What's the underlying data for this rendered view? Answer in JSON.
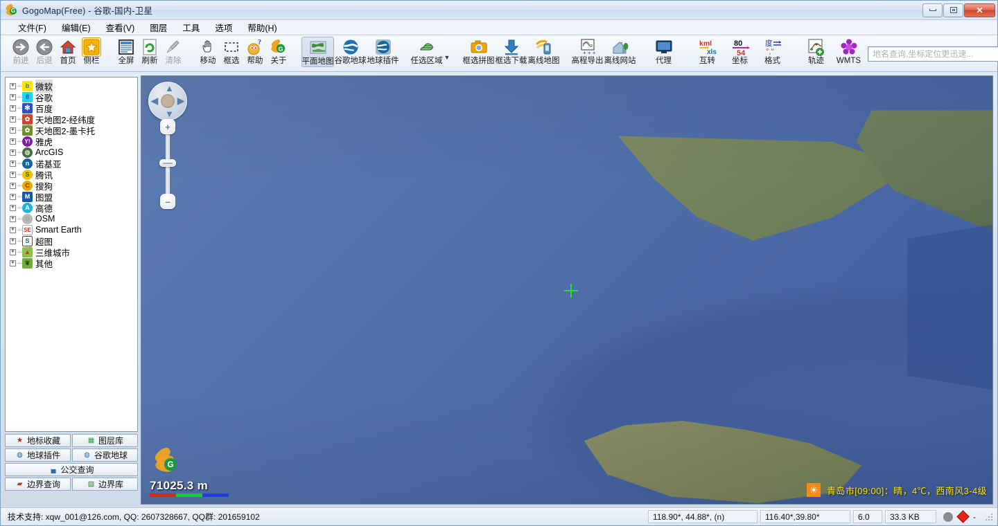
{
  "window": {
    "title": "GogoMap(Free) - 谷歌-国内-卫星",
    "logo_letter": "G",
    "minimize": "—",
    "maximize": "❐",
    "close": "✕"
  },
  "menubar": {
    "items": [
      {
        "label": "文件(F)"
      },
      {
        "label": "编辑(E)"
      },
      {
        "label": "查看(V)"
      },
      {
        "label": "图层"
      },
      {
        "label": "工具"
      },
      {
        "label": "选项"
      },
      {
        "label": "帮助(H)"
      }
    ]
  },
  "toolbar": {
    "groups": [
      {
        "buttons": [
          {
            "label": "前进",
            "icon": "arrow-right-circle-icon",
            "dim": true,
            "glyph": "➜",
            "color": "#5a5a5a"
          },
          {
            "label": "后退",
            "icon": "arrow-left-circle-icon",
            "dim": true,
            "glyph": "➜",
            "color": "#5a5a5a"
          },
          {
            "label": "首页",
            "icon": "home-icon",
            "dim": false,
            "glyph": "⌂",
            "color": "#c0392b"
          },
          {
            "label": "侧栏",
            "icon": "sidebar-star-icon",
            "dim": false,
            "glyph": "★",
            "color": "#f0a500",
            "selected": true
          }
        ]
      },
      {
        "buttons": [
          {
            "label": "全屏",
            "icon": "fullscreen-icon",
            "dim": false,
            "glyph": "▤",
            "color": "#2b6cb0"
          },
          {
            "label": "刷新",
            "icon": "refresh-icon",
            "dim": false,
            "glyph": "↻",
            "color": "#2e8b2e"
          },
          {
            "label": "清除",
            "icon": "broom-icon",
            "dim": true,
            "glyph": "🧹",
            "color": "#8a8a8a"
          }
        ]
      },
      {
        "buttons": [
          {
            "label": "移动",
            "icon": "hand-pan-icon",
            "dim": false,
            "glyph": "✋",
            "color": "#555"
          },
          {
            "label": "框选",
            "icon": "marquee-icon",
            "dim": false,
            "glyph": "▭",
            "color": "#555"
          },
          {
            "label": "帮助",
            "icon": "help-face-icon",
            "dim": false,
            "glyph": "?",
            "color": "#e8a33d"
          },
          {
            "label": "关于",
            "icon": "about-logo-icon",
            "dim": false,
            "glyph": "G",
            "color": "#1a9a3c"
          }
        ]
      },
      {
        "buttons": [
          {
            "label": "平面地图",
            "icon": "flat-map-icon",
            "dim": false,
            "glyph": "🌎",
            "color": "#2f7d32",
            "selected2": true
          },
          {
            "label": "谷歌地球",
            "icon": "google-earth-icon",
            "dim": false,
            "glyph": "◍",
            "color": "#1f6fb4"
          },
          {
            "label": "地球插件",
            "icon": "earth-plugin-icon",
            "dim": false,
            "glyph": "◍",
            "color": "#16669e"
          }
        ]
      },
      {
        "buttons": [
          {
            "label": "任选区域",
            "icon": "select-region-icon",
            "dim": false,
            "glyph": "▱",
            "color": "#2f9e44",
            "dropdown": true
          }
        ]
      },
      {
        "buttons": [
          {
            "label": "框选拼图",
            "icon": "camera-stitch-icon",
            "dim": false,
            "glyph": "📷",
            "color": "#f0a500"
          },
          {
            "label": "框选下载",
            "icon": "download-icon",
            "dim": false,
            "glyph": "⬇",
            "color": "#1f6fb4"
          },
          {
            "label": "离线地图",
            "icon": "offline-map-icon",
            "dim": false,
            "glyph": "📱",
            "color": "#f0a500"
          }
        ]
      },
      {
        "buttons": [
          {
            "label": "高程导出",
            "icon": "elevation-export-icon",
            "dim": false,
            "glyph": "▨",
            "color": "#333"
          },
          {
            "label": "离线网站",
            "icon": "offline-site-icon",
            "dim": false,
            "glyph": "⌂",
            "color": "#5a7fa8"
          }
        ]
      },
      {
        "buttons": [
          {
            "label": "代理",
            "icon": "proxy-monitor-icon",
            "dim": false,
            "glyph": "▭",
            "color": "#1c3d66"
          }
        ]
      },
      {
        "buttons": [
          {
            "label": "互转",
            "icon": "kml-xls-convert-icon",
            "dim": false,
            "glyph": "kml",
            "color": "#d93025"
          },
          {
            "label": "坐标",
            "icon": "coordinate-icon",
            "dim": false,
            "glyph": "80",
            "color": "#111"
          },
          {
            "label": "格式",
            "icon": "format-icon",
            "dim": false,
            "glyph": "度",
            "color": "#2b3fa0"
          }
        ]
      },
      {
        "buttons": [
          {
            "label": "轨迹",
            "icon": "track-icon",
            "dim": false,
            "glyph": "⤳",
            "color": "#c0392b"
          },
          {
            "label": "WMTS",
            "icon": "wmts-icon",
            "dim": false,
            "glyph": "✺",
            "color": "#a324c4"
          }
        ]
      }
    ],
    "kml_top": "kml",
    "kml_bottom": "xls",
    "coord_top": "80",
    "coord_bottom": "54",
    "format_top": "度",
    "format_bottom": "°,''"
  },
  "search": {
    "placeholder": "地名查询,坐标定位更迅速...",
    "value": ""
  },
  "sidebar": {
    "tree": [
      {
        "label": "微软",
        "expander": "+",
        "icon_letter": "b",
        "bg": "#ffe400",
        "fg": "#2b6cb0",
        "selected": true
      },
      {
        "label": "谷歌",
        "expander": "+",
        "icon_letter": "8",
        "bg": "#21d4f0",
        "fg": "#1559a8"
      },
      {
        "label": "百度",
        "expander": "+",
        "icon_letter": "熊",
        "bg": "#2b52c4",
        "fg": "#ffffff"
      },
      {
        "label": "天地图2-经纬度",
        "expander": "+",
        "icon_letter": "★",
        "bg": "#d0452e",
        "fg": "#ffffff"
      },
      {
        "label": "天地图2-墨卡托",
        "expander": "+",
        "icon_letter": "★",
        "bg": "#6f8f2a",
        "fg": "#ffffff"
      },
      {
        "label": "雅虎",
        "expander": "+",
        "icon_letter": "Y!",
        "bg": "#7b1fa2",
        "fg": "#ffffff"
      },
      {
        "label": "ArcGIS",
        "expander": "+",
        "icon_letter": "◍",
        "bg": "#4a6b4a",
        "fg": "#ffffff"
      },
      {
        "label": "诺基亚",
        "expander": "+",
        "icon_letter": "n",
        "bg": "#12639e",
        "fg": "#ffffff"
      },
      {
        "label": "腾讯",
        "expander": "+",
        "icon_letter": "S",
        "bg": "#f2c200",
        "fg": "#1a7a2e"
      },
      {
        "label": "搜狗",
        "expander": "+",
        "icon_letter": "C",
        "bg": "#f0a500",
        "fg": "#5a4500"
      },
      {
        "label": "图盟",
        "expander": "+",
        "icon_letter": "M",
        "bg": "#1559a8",
        "fg": "#ffffff"
      },
      {
        "label": "高德",
        "expander": "+",
        "icon_letter": "A",
        "bg": "#19b6d9",
        "fg": "#ffffff"
      },
      {
        "label": "OSM",
        "expander": "+",
        "icon_letter": "◌",
        "bg": "#b7b7b7",
        "fg": "#4a4a4a"
      },
      {
        "label": "Smart Earth",
        "expander": "+",
        "icon_letter": "SE",
        "bg": "#ffffff",
        "fg": "#c0392b"
      },
      {
        "label": "超图",
        "expander": "+",
        "icon_letter": "S",
        "bg": "#ffffff",
        "fg": "#1559a8"
      },
      {
        "label": "三维城市",
        "expander": "+",
        "icon_letter": "🏙",
        "bg": "#8fbf4a",
        "fg": "#c0392b"
      },
      {
        "label": "其他",
        "expander": "+",
        "icon_letter": "🌴",
        "bg": "#6fae3a",
        "fg": "#2d5a16"
      }
    ],
    "buttons": [
      [
        {
          "label": "地标收藏",
          "icon": "star-icon",
          "glyph": "★",
          "color": "#d01818"
        },
        {
          "label": "图层库",
          "icon": "layer-library-icon",
          "glyph": "▦",
          "color": "#2e9e3a"
        }
      ],
      [
        {
          "label": "地球插件",
          "icon": "earth-plugin-icon",
          "glyph": "◍",
          "color": "#16669e"
        },
        {
          "label": "谷歌地球",
          "icon": "google-earth-icon",
          "glyph": "◍",
          "color": "#1f6fb4"
        }
      ],
      [
        {
          "label": "公交查询",
          "icon": "bus-icon",
          "glyph": "🚌",
          "color": "#2b6cb0",
          "full": true
        }
      ],
      [
        {
          "label": "边界查询",
          "icon": "boundary-query-icon",
          "glyph": "▰",
          "color": "#c0392b"
        },
        {
          "label": "边界库",
          "icon": "boundary-lib-icon",
          "glyph": "🗺",
          "color": "#2f7d32"
        }
      ]
    ]
  },
  "map": {
    "scale_label": "71025.3 m",
    "scale_colors": [
      "#e82020",
      "#1ecb1e",
      "#1f3fd8"
    ],
    "nav": {
      "up": "▲",
      "down": "▼",
      "left": "◀",
      "right": "▶",
      "zoom_in": "+",
      "zoom_out": "–"
    },
    "watermark_letter": "G",
    "crosshair_color": "#29e029",
    "weather": {
      "icon": "sun-icon",
      "glyph": "☀",
      "text": "青岛市[09:00]：晴，4℃，西南风3-4级"
    }
  },
  "statusbar": {
    "support": "技术支持: xqw_001@126.com, QQ: 2607328667, QQ群: 201659102",
    "cursor_coords": "118.90*, 44.88*, (n)",
    "center_coords": "116.40*,39.80*",
    "zoom_level": "6.0",
    "cache_size": "33.3 KB",
    "dash": "-"
  }
}
